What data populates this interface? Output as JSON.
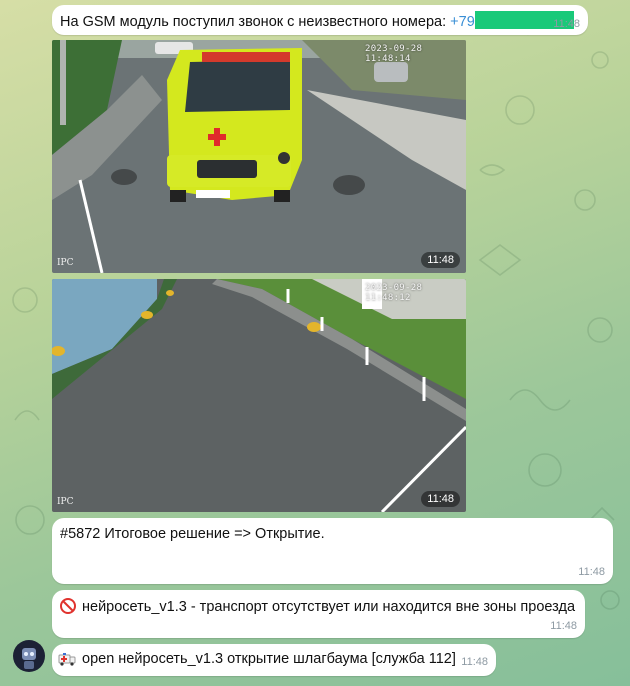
{
  "colors": {
    "accent_link": "#3a8fd6",
    "phone_mask": "#19c979",
    "bubble": "#ffffff",
    "timestamp": "#8e9aa3"
  },
  "messages": {
    "incoming_call": {
      "text": "На GSM модуль поступил звонок с неизвестного номера: ",
      "phone_prefix": "+79",
      "time": "11:48"
    },
    "photo_1": {
      "time": "11:48",
      "camera_timestamp": "2023-09-28 11:48:14",
      "camera_brand": "IPC",
      "vehicle_sign": "РЕАНИМАЦИЯ"
    },
    "photo_2": {
      "time": "11:48",
      "camera_timestamp": "2023-09-28 11:48:12",
      "camera_brand": "IPC"
    },
    "decision": {
      "text": "#5872 Итоговое решение => Открытие.",
      "time": "11:48"
    },
    "nn_check": {
      "icon": "no-entry-icon",
      "text": "нейросеть_v1.3 - транспорт отсутствует или находится вне зоны проезда",
      "time": "11:48"
    },
    "open_cmd": {
      "icon": "ambulance-icon",
      "text": "open нейросеть_v1.3 открытие шлагбаума [служба 112]",
      "time": "11:48"
    }
  }
}
